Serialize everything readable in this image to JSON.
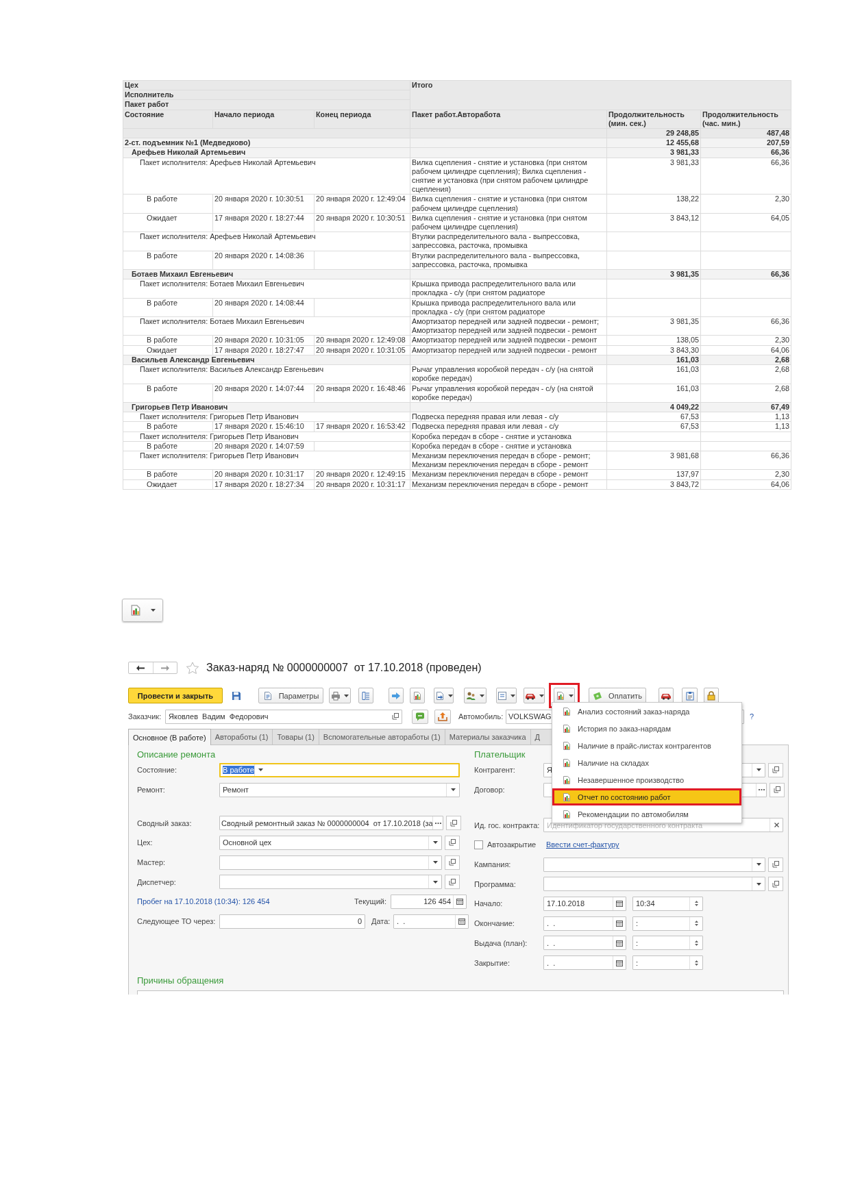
{
  "report": {
    "grouping_headers": [
      "Цех",
      "Исполнитель",
      "Пакет работ"
    ],
    "total_header": "Итого",
    "columns": [
      "Состояние",
      "Начало периода",
      "Конец периода",
      "Пакет работ.Авторабота",
      "Продолжительность (мин. сек.)",
      "Продолжительность (час. мин.)"
    ],
    "grand_total": {
      "min_sec": "29 248,85",
      "hour_min": "487,48"
    },
    "rows": [
      {
        "kind": "workshop",
        "name": "2-ст. подъемник №1 (Медведково)",
        "min_sec": "12 455,68",
        "hour_min": "207,59"
      },
      {
        "kind": "executor",
        "name": "Арефьев Николай Артемьевич",
        "min_sec": "3 981,33",
        "hour_min": "66,36"
      },
      {
        "kind": "package",
        "name": "Пакет исполнителя: Арефьев Николай Артемьевич",
        "work": "Вилка сцепления - снятие и установка (при снятом рабочем цилиндре сцепления); Вилка сцепления - снятие и установка (при снятом рабочем цилиндре сцепления)",
        "min_sec": "3 981,33",
        "hour_min": "66,36"
      },
      {
        "kind": "state",
        "state": "В работе",
        "start": "20 января 2020 г. 10:30:51",
        "end": "20 января 2020 г. 12:49:04",
        "work": "Вилка сцепления - снятие и установка (при снятом рабочем цилиндре сцепления)",
        "min_sec": "138,22",
        "hour_min": "2,30"
      },
      {
        "kind": "state",
        "state": "Ожидает",
        "start": "17 января 2020 г. 18:27:44",
        "end": "20 января 2020 г. 10:30:51",
        "work": "Вилка сцепления - снятие и установка (при снятом рабочем цилиндре сцепления)",
        "min_sec": "3 843,12",
        "hour_min": "64,05"
      },
      {
        "kind": "package",
        "name": "Пакет исполнителя: Арефьев Николай Артемьевич",
        "work": "Втулки распределительного вала - выпрессовка, запрессовка, расточка, промывка"
      },
      {
        "kind": "state",
        "state": "В работе",
        "start": "20 января 2020 г. 14:08:36",
        "work": "Втулки распределительного вала - выпрессовка, запрессовка, расточка, промывка"
      },
      {
        "kind": "executor",
        "name": "Ботаев Михаил Евгеньевич",
        "min_sec": "3 981,35",
        "hour_min": "66,36"
      },
      {
        "kind": "package",
        "name": "Пакет исполнителя: Ботаев Михаил Евгеньевич",
        "work": "Крышка привода распределительного вала или прокладка - с/у (при снятом радиаторе"
      },
      {
        "kind": "state",
        "state": "В работе",
        "start": "20 января 2020 г. 14:08:44",
        "work": "Крышка привода распределительного вала или прокладка - с/у (при снятом радиаторе"
      },
      {
        "kind": "package",
        "name": "Пакет исполнителя: Ботаев Михаил Евгеньевич",
        "work": "Амортизатор передней или задней подвески - ремонт; Амортизатор передней или задней подвески - ремонт",
        "min_sec": "3 981,35",
        "hour_min": "66,36"
      },
      {
        "kind": "state",
        "state": "В работе",
        "start": "20 января 2020 г. 10:31:05",
        "end": "20 января 2020 г. 12:49:08",
        "work": "Амортизатор передней или задней подвески - ремонт",
        "min_sec": "138,05",
        "hour_min": "2,30"
      },
      {
        "kind": "state",
        "state": "Ожидает",
        "start": "17 января 2020 г. 18:27:47",
        "end": "20 января 2020 г. 10:31:05",
        "work": "Амортизатор передней или задней подвески - ремонт",
        "min_sec": "3 843,30",
        "hour_min": "64,06"
      },
      {
        "kind": "executor",
        "name": "Васильев Александр Евгеньевич",
        "min_sec": "161,03",
        "hour_min": "2,68"
      },
      {
        "kind": "package",
        "name": "Пакет исполнителя: Васильев Александр Евгеньевич",
        "work": "Рычаг управления коробкой передач - с/у (на снятой коробке передач)",
        "min_sec": "161,03",
        "hour_min": "2,68"
      },
      {
        "kind": "state",
        "state": "В работе",
        "start": "20 января 2020 г. 14:07:44",
        "end": "20 января 2020 г. 16:48:46",
        "work": "Рычаг управления коробкой передач - с/у (на снятой коробке передач)",
        "min_sec": "161,03",
        "hour_min": "2,68"
      },
      {
        "kind": "executor",
        "name": "Григорьев Петр Иванович",
        "min_sec": "4 049,22",
        "hour_min": "67,49"
      },
      {
        "kind": "package",
        "name": "Пакет исполнителя: Григорьев Петр Иванович",
        "work": "Подвеска передняя правая или левая - с/у",
        "min_sec": "67,53",
        "hour_min": "1,13"
      },
      {
        "kind": "state",
        "state": "В работе",
        "start": "17 января 2020 г. 15:46:10",
        "end": "17 января 2020 г. 16:53:42",
        "work": "Подвеска передняя правая или левая - с/у",
        "min_sec": "67,53",
        "hour_min": "1,13"
      },
      {
        "kind": "package",
        "name": "Пакет исполнителя: Григорьев Петр Иванович",
        "work": "Коробка передач в сборе - снятие и установка"
      },
      {
        "kind": "state",
        "state": "В работе",
        "start": "20 января 2020 г. 14:07:59",
        "work": "Коробка передач в сборе - снятие и установка"
      },
      {
        "kind": "package",
        "name": "Пакет исполнителя: Григорьев Петр Иванович",
        "work": "Механизм переключения передач в сборе - ремонт; Механизм переключения передач в сборе - ремонт",
        "min_sec": "3 981,68",
        "hour_min": "66,36"
      },
      {
        "kind": "state",
        "state": "В работе",
        "start": "20 января 2020 г. 10:31:17",
        "end": "20 января 2020 г. 12:49:15",
        "work": "Механизм переключения передач в сборе - ремонт",
        "min_sec": "137,97",
        "hour_min": "2,30"
      },
      {
        "kind": "state",
        "state": "Ожидает",
        "start": "17 января 2020 г. 18:27:34",
        "end": "20 января 2020 г. 10:31:17",
        "work": "Механизм переключения передач в сборе - ремонт",
        "min_sec": "3 843,72",
        "hour_min": "64,06"
      }
    ]
  },
  "report_button": {
    "kind": "icon-dropdown"
  },
  "form": {
    "title": "Заказ-наряд № 0000000007  от 17.10.2018 (проведен)",
    "favorite": false,
    "toolbar": [
      {
        "kind": "primary",
        "label": "Провести и закрыть",
        "marked": false
      },
      {
        "kind": "icon",
        "marked": false
      },
      {
        "kind": "labeled",
        "label": "Параметры",
        "marked": false
      },
      {
        "kind": "icon-dropdown",
        "marked": false
      },
      {
        "kind": "icon-button",
        "marked": false
      },
      {
        "kind": "icon-button",
        "marked": false
      },
      {
        "kind": "icon-button",
        "marked": false
      },
      {
        "kind": "icon-dropdown",
        "marked": false
      },
      {
        "kind": "icon-dropdown",
        "marked": false
      },
      {
        "kind": "icon-dropdown",
        "marked": false
      },
      {
        "kind": "icon-dropdown",
        "marked": false
      },
      {
        "kind": "icon-dropdown",
        "marked": true
      },
      {
        "kind": "labeled",
        "label": "Оплатить",
        "marked": false
      },
      {
        "kind": "icon-button",
        "marked": false
      },
      {
        "kind": "icon-button",
        "marked": false
      },
      {
        "kind": "icon-button",
        "marked": false
      }
    ],
    "customer": {
      "label": "Заказчик:",
      "value": "Яковлев  Вадим  Федорович"
    },
    "car": {
      "label": "Автомобиль:",
      "value": "VOLKSWAG"
    },
    "help": "?",
    "tabs": [
      {
        "label": "Основное (В работе)",
        "selected": true
      },
      {
        "label": "Автоработы (1)",
        "selected": false
      },
      {
        "label": "Товары (1)",
        "selected": false
      },
      {
        "label": "Вспомогательные автоработы (1)",
        "selected": false
      },
      {
        "label": "Материалы заказчика",
        "selected": false
      },
      {
        "label": "Д",
        "selected": false
      }
    ],
    "repair": {
      "heading": "Описание ремонта",
      "fields": [
        {
          "kind": "select",
          "label": "Состояние:",
          "value": "В работе",
          "focused": true
        },
        {
          "kind": "select",
          "label": "Ремонт:",
          "value": "Ремонт",
          "focused": false
        },
        {
          "kind": "spacer"
        },
        {
          "kind": "choice",
          "label": "Сводный заказ:",
          "value": "Сводный ремонтный заказ № 0000000004  от 17.10.2018 (за",
          "focused": false
        },
        {
          "kind": "select-open",
          "label": "Цех:",
          "value": "Основной цех",
          "focused": false
        },
        {
          "kind": "select-open",
          "label": "Мастер:",
          "focused": false
        },
        {
          "kind": "select-open",
          "label": "Диспетчер:",
          "focused": false
        }
      ]
    },
    "mileage": {
      "link": "Пробег на 17.10.2018 (10:34): 126 454",
      "current_label": "Текущий:",
      "current_value": "126 454",
      "next_label": "Следующее ТО через:",
      "next_value": "0",
      "date_label": "Дата:",
      "date_value": ".  ."
    },
    "payer": {
      "heading": "Плательщик",
      "fields": [
        {
          "kind": "select-open",
          "label": "Контрагент:",
          "value": "Я"
        },
        {
          "kind": "choice",
          "label": "Договор:"
        },
        {
          "kind": "spacer"
        },
        {
          "kind": "clear",
          "label": "Ид. гос. контракта:",
          "placeholder": "Идентификатор государственного контракта"
        }
      ],
      "autoclose": {
        "label": "Автозакрытие",
        "checked": false
      },
      "invoice_link": "Ввести счет-фактуру",
      "more_fields": [
        {
          "kind": "select-open",
          "label": "Кампания:"
        },
        {
          "kind": "select-open",
          "label": "Программа:"
        }
      ],
      "dates": [
        {
          "label": "Начало:",
          "date": "17.10.2018",
          "time": "10:34"
        },
        {
          "label": "Окончание:",
          "date": ".  .",
          "time": ":"
        },
        {
          "label": "Выдача (план):",
          "date": ".  .",
          "time": ":"
        },
        {
          "label": "Закрытие:",
          "date": ".  .",
          "time": ":"
        }
      ]
    },
    "reasons_heading": "Причины обращения",
    "menu": [
      {
        "label": "Анализ состояний заказ-наряда",
        "selected": false,
        "marked": false
      },
      {
        "label": "История по заказ-нарядам",
        "selected": false,
        "marked": false
      },
      {
        "label": "Наличие в прайс-листах контрагентов",
        "selected": false,
        "marked": false
      },
      {
        "label": "Наличие на складах",
        "selected": false,
        "marked": false
      },
      {
        "label": "Незавершенное производство",
        "selected": false,
        "marked": false
      },
      {
        "label": "Отчет по состоянию работ",
        "selected": true,
        "marked": true
      },
      {
        "label": "Рекомендации по автомобилям",
        "selected": false,
        "marked": false
      }
    ]
  }
}
